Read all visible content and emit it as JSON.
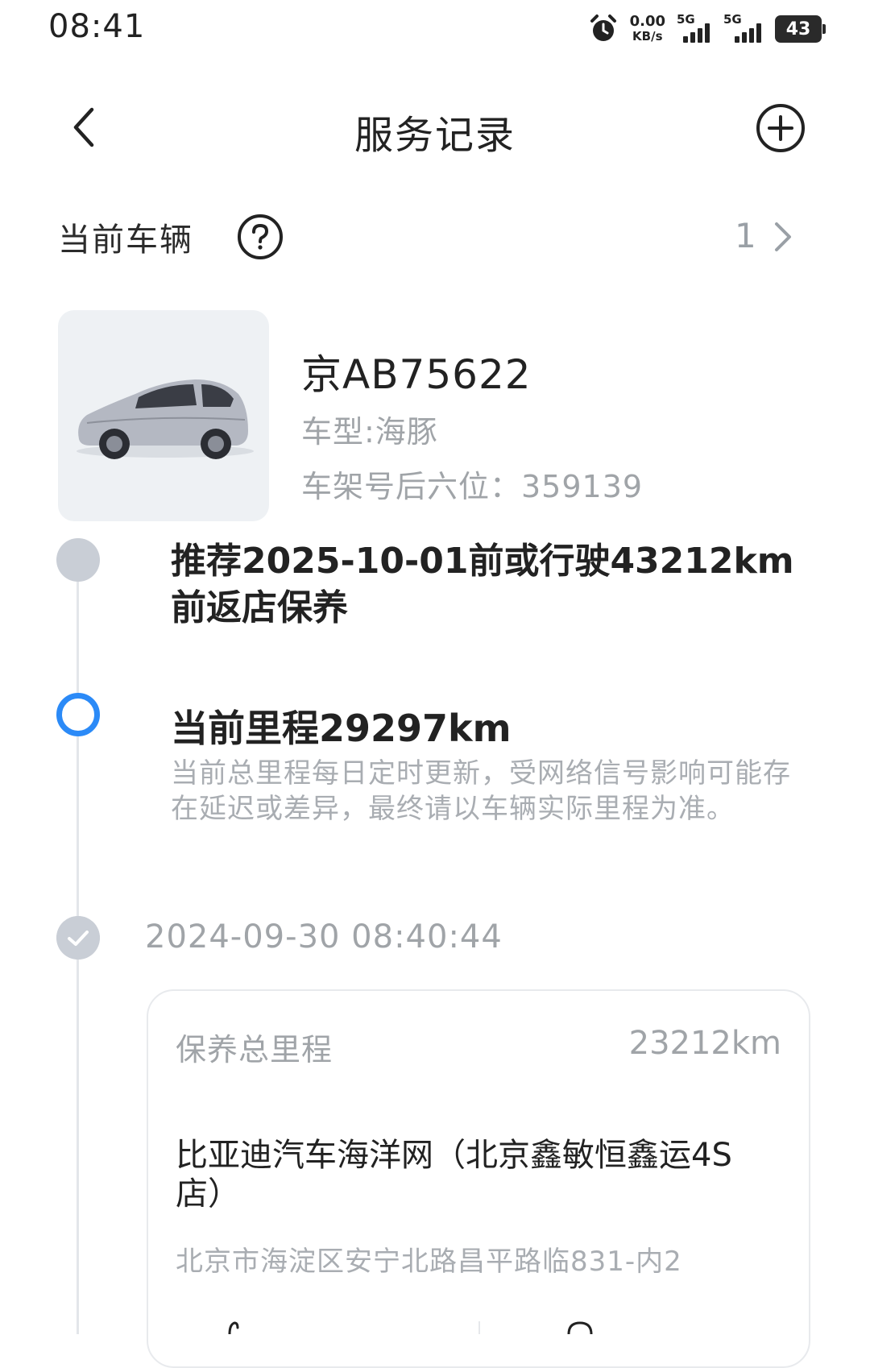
{
  "status_bar": {
    "time": "08:41",
    "net_rate": "0.00",
    "net_unit": "KB/s",
    "sim1": "5G",
    "sim2": "5G",
    "battery": "43",
    "icons": [
      "alarm-icon",
      "signal-icon",
      "signal-icon",
      "battery-icon"
    ]
  },
  "header": {
    "title": "服务记录",
    "back_icon": "chevron-left-icon",
    "add_icon": "plus-circle-icon"
  },
  "current_vehicle": {
    "label": "当前车辆",
    "help_icon": "question-circle-icon",
    "count": "1",
    "chevron_icon": "chevron-right-icon"
  },
  "vehicle": {
    "plate": "京AB75622",
    "model": "车型:海豚",
    "vin": "车架号后六位：359139"
  },
  "timeline": {
    "recommendation": "推荐2025-10-01前或行驶43212km前返店保养",
    "current_odometer": "当前里程29297km",
    "odometer_note": "当前总里程每日定时更新，受网络信号影响可能存在延迟或差异，最终请以车辆实际里程为准。",
    "record_date": "2024-09-30 08:40:44"
  },
  "service_card": {
    "mileage_label": "保养总里程",
    "mileage_value": "23212km",
    "shop_name": "比亚迪汽车海洋网（北京鑫敏恒鑫运4S店）",
    "address": "北京市海淀区安宁北路昌平路临831-内2"
  },
  "colors": {
    "accent": "#2b8af7",
    "muted_text": "#a0a4a8",
    "dot_gray": "#c9ced6",
    "line": "#e3e6ea"
  }
}
